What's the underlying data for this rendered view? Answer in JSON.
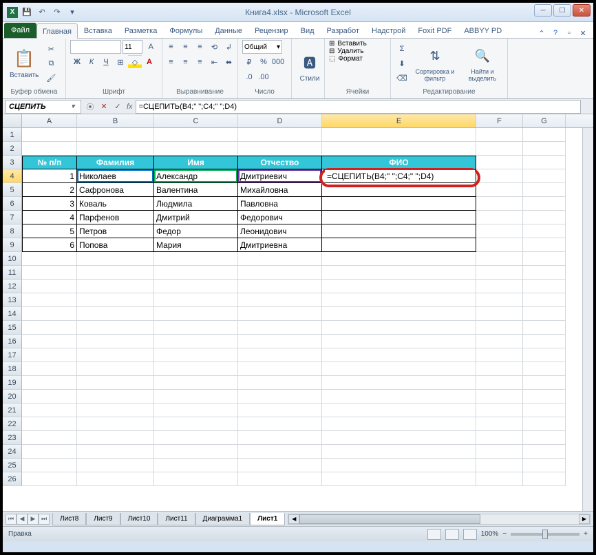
{
  "window": {
    "title": "Книга4.xlsx - Microsoft Excel"
  },
  "tabs": {
    "file": "Файл",
    "items": [
      "Главная",
      "Вставка",
      "Разметка",
      "Формулы",
      "Данные",
      "Рецензир",
      "Вид",
      "Разработ",
      "Надстрой",
      "Foxit PDF",
      "ABBYY PD"
    ],
    "active_index": 0
  },
  "ribbon": {
    "clipboard": {
      "paste": "Вставить",
      "label": "Буфер обмена"
    },
    "font": {
      "size": "11",
      "label": "Шрифт"
    },
    "alignment": {
      "label": "Выравнивание"
    },
    "number": {
      "format": "Общий",
      "label": "Число"
    },
    "styles": {
      "btn": "Стили",
      "label": ""
    },
    "cells": {
      "insert": "Вставить",
      "delete": "Удалить",
      "format": "Формат",
      "label": "Ячейки"
    },
    "editing": {
      "sort": "Сортировка и фильтр",
      "find": "Найти и выделить",
      "label": "Редактирование"
    }
  },
  "namebox": "СЦЕПИТЬ",
  "formula": "=СЦЕПИТЬ(B4;\" \";C4;\" \";D4)",
  "columns": [
    "A",
    "B",
    "C",
    "D",
    "E",
    "F",
    "G"
  ],
  "table": {
    "headers": {
      "a": "№ п/п",
      "b": "Фамилия",
      "c": "Имя",
      "d": "Отчество",
      "e": "ФИО"
    },
    "rows": [
      {
        "n": "1",
        "b": "Николаев",
        "c": "Александр",
        "d": "Дмитриевич"
      },
      {
        "n": "2",
        "b": "Сафронова",
        "c": "Валентина",
        "d": "Михайловна"
      },
      {
        "n": "3",
        "b": "Коваль",
        "c": "Людмила",
        "d": "Павловна"
      },
      {
        "n": "4",
        "b": "Парфенов",
        "c": "Дмитрий",
        "d": "Федорович"
      },
      {
        "n": "5",
        "b": "Петров",
        "c": "Федор",
        "d": "Леонидович"
      },
      {
        "n": "6",
        "b": "Попова",
        "c": "Мария",
        "d": "Дмитриевна"
      }
    ]
  },
  "active_cell_formula": "=СЦЕПИТЬ(B4;\" \";C4;\" \";D4)",
  "sheets": {
    "list": [
      "Лист8",
      "Лист9",
      "Лист10",
      "Лист11",
      "Диаграмма1",
      "Лист1"
    ],
    "active_index": 5
  },
  "statusbar": {
    "mode": "Правка",
    "zoom": "100%"
  }
}
